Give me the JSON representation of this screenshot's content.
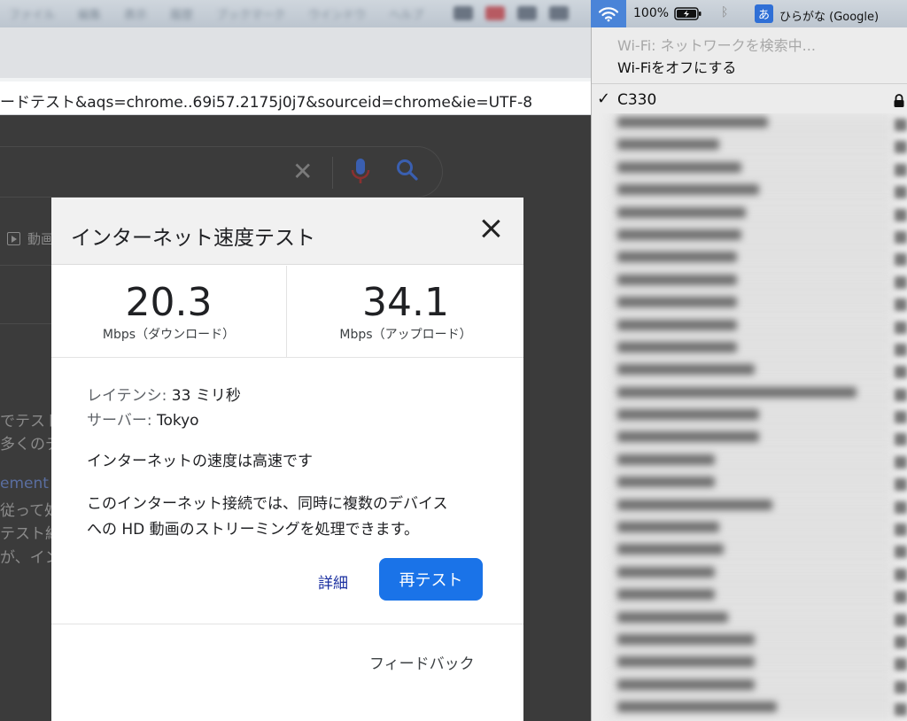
{
  "menubar": {
    "app_menus": [
      "ファイル",
      "編集",
      "表示",
      "履歴",
      "ブックマーク",
      "ウインドウ",
      "ヘルプ"
    ],
    "battery_percent": "100%",
    "input_source_icon": "あ",
    "input_source_name": "ひらがな (Google)",
    "icons": [
      "wifi-icon",
      "battery-charging-icon",
      "bluetooth-icon"
    ]
  },
  "browser": {
    "url_text": "ードテスト&aqs=chrome..69i57.2175j0j7&sourceid=chrome&ie=UTF-8"
  },
  "page": {
    "tab_video": "動画",
    "bg_lines": [
      "でテスト",
      "多くのデ",
      "ement L",
      "従って処",
      "テスト結",
      "が、イン"
    ]
  },
  "dialog": {
    "title": "インターネット速度テスト",
    "download": {
      "value": "20.3",
      "unit": "Mbps（ダウンロード）"
    },
    "upload": {
      "value": "34.1",
      "unit": "Mbps（アップロード）"
    },
    "latency_label": "レイテンシ:",
    "latency_value": "33 ミリ秒",
    "server_label": "サーバー:",
    "server_value": "Tokyo",
    "speed_verdict": "インターネットの速度は高速です",
    "description_line1": "このインターネット接続では、同時に複数のデバイス",
    "description_line2": "への HD 動画のストリーミングを処理できます。",
    "details_link": "詳細",
    "retest_button": "再テスト",
    "feedback_link": "フィードバック",
    "accent_color": "#1a73e8"
  },
  "wifi_menu": {
    "status": "Wi-Fi: ネットワークを検索中...",
    "turn_off": "Wi-Fiをオフにする",
    "current_network": "C330",
    "other_networks_count_visible": 27
  }
}
